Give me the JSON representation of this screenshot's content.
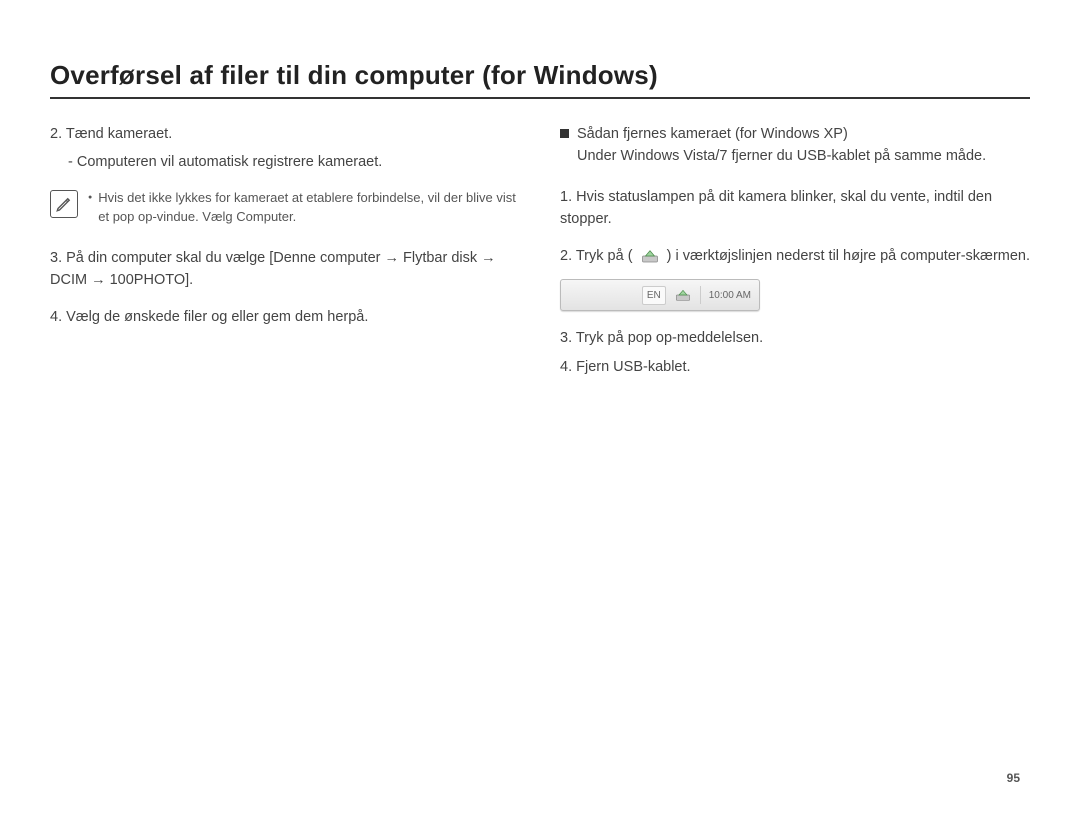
{
  "title": "Overførsel af filer til din computer (for Windows)",
  "left": {
    "step2": "2. Tænd kameraet.",
    "step2_sub": "- Computeren vil automatisk registrere kameraet.",
    "note": "Hvis det ikke lykkes for kameraet at etablere forbindelse, vil der blive vist et pop op-vindue. Vælg Computer.",
    "step3": "3. På din computer skal du vælge [Denne computer → Flytbar disk → DCIM → 100PHOTO].",
    "step4": "4. Vælg de ønskede filer og eller gem dem herpå."
  },
  "right": {
    "section_title": "Sådan fjernes kameraet (for Windows XP)",
    "section_sub": "Under Windows Vista/7 fjerner du USB-kablet på samme måde.",
    "step1": "1. Hvis statuslampen på dit kamera blinker, skal du vente, indtil den stopper.",
    "step2_a": "2. Tryk på (",
    "step2_b": ") i værktøjslinjen nederst til højre på computer-skærmen.",
    "tray": {
      "lang": "EN",
      "time": "10:00 AM"
    },
    "step3": "3. Tryk på pop op-meddelelsen.",
    "step4": "4. Fjern USB-kablet."
  },
  "page_number": "95"
}
